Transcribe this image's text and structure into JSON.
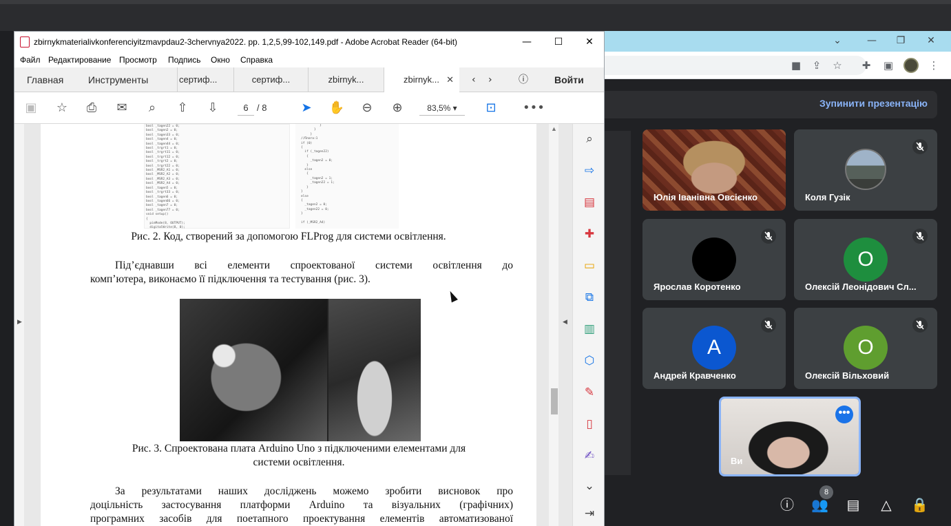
{
  "acrobat": {
    "title": "zbirnykmaterialivkonferenciyitzmavpdau2-3chervnya2022. pp. 1,2,5,99-102,149.pdf - Adobe Acrobat Reader (64-bit)",
    "menu": [
      "Файл",
      "Редактирование",
      "Просмотр",
      "Подпись",
      "Окно",
      "Справка"
    ],
    "nav_tabs": {
      "home": "Главная",
      "tools": "Инструменты"
    },
    "doc_tabs": [
      "сертиф...",
      "сертиф...",
      "zbirnyk...",
      "zbirnyk..."
    ],
    "signin": "Войти",
    "page_current": "6",
    "page_total": "/ 8",
    "zoom": "83,5%"
  },
  "document": {
    "caption2": "Рис. 2. Код, створений за допомогою FLProg для системи освітлення.",
    "para1_line1": "Під’єднавши всі елементи спроектованої системи освітлення до",
    "para1_line2": "комп’ютера, виконаємо її підключення та тестування (рис. 3).",
    "caption3_line1": "Рис. 3. Спроектована плата Arduino Uno з підключеними елементами для",
    "caption3_line2": "системи освітлення.",
    "para2_line1": "За результатами наших досліджень можемо зробити висновок про",
    "para2_line2": "доцільність застосування платформи Arduino та візуальних (графічних)",
    "para2_line3": "програмних засобів для поетапного проектування елементів автоматизованої"
  },
  "meet": {
    "stop_presenting": "Зупинити презентацію",
    "participants": [
      {
        "name": "Юлія Іванівна Овсієнко",
        "kind": "video"
      },
      {
        "name": "Коля Гузік",
        "kind": "photo",
        "muted": true
      },
      {
        "name": "Ярослав Коротенко",
        "kind": "avatar",
        "letter": "",
        "color": "#000000",
        "muted": true
      },
      {
        "name": "Олексій Леонідович Сл...",
        "kind": "avatar",
        "letter": "О",
        "color": "#1e8e3e",
        "muted": true
      },
      {
        "name": "Андрей Кравченко",
        "kind": "avatar",
        "letter": "А",
        "color": "#0b57d0",
        "muted": true
      },
      {
        "name": "Олексій Вільховий",
        "kind": "avatar",
        "letter": "О",
        "color": "#5f9e2f",
        "muted": true
      }
    ],
    "self_name": "Ви",
    "participant_count": "8"
  }
}
